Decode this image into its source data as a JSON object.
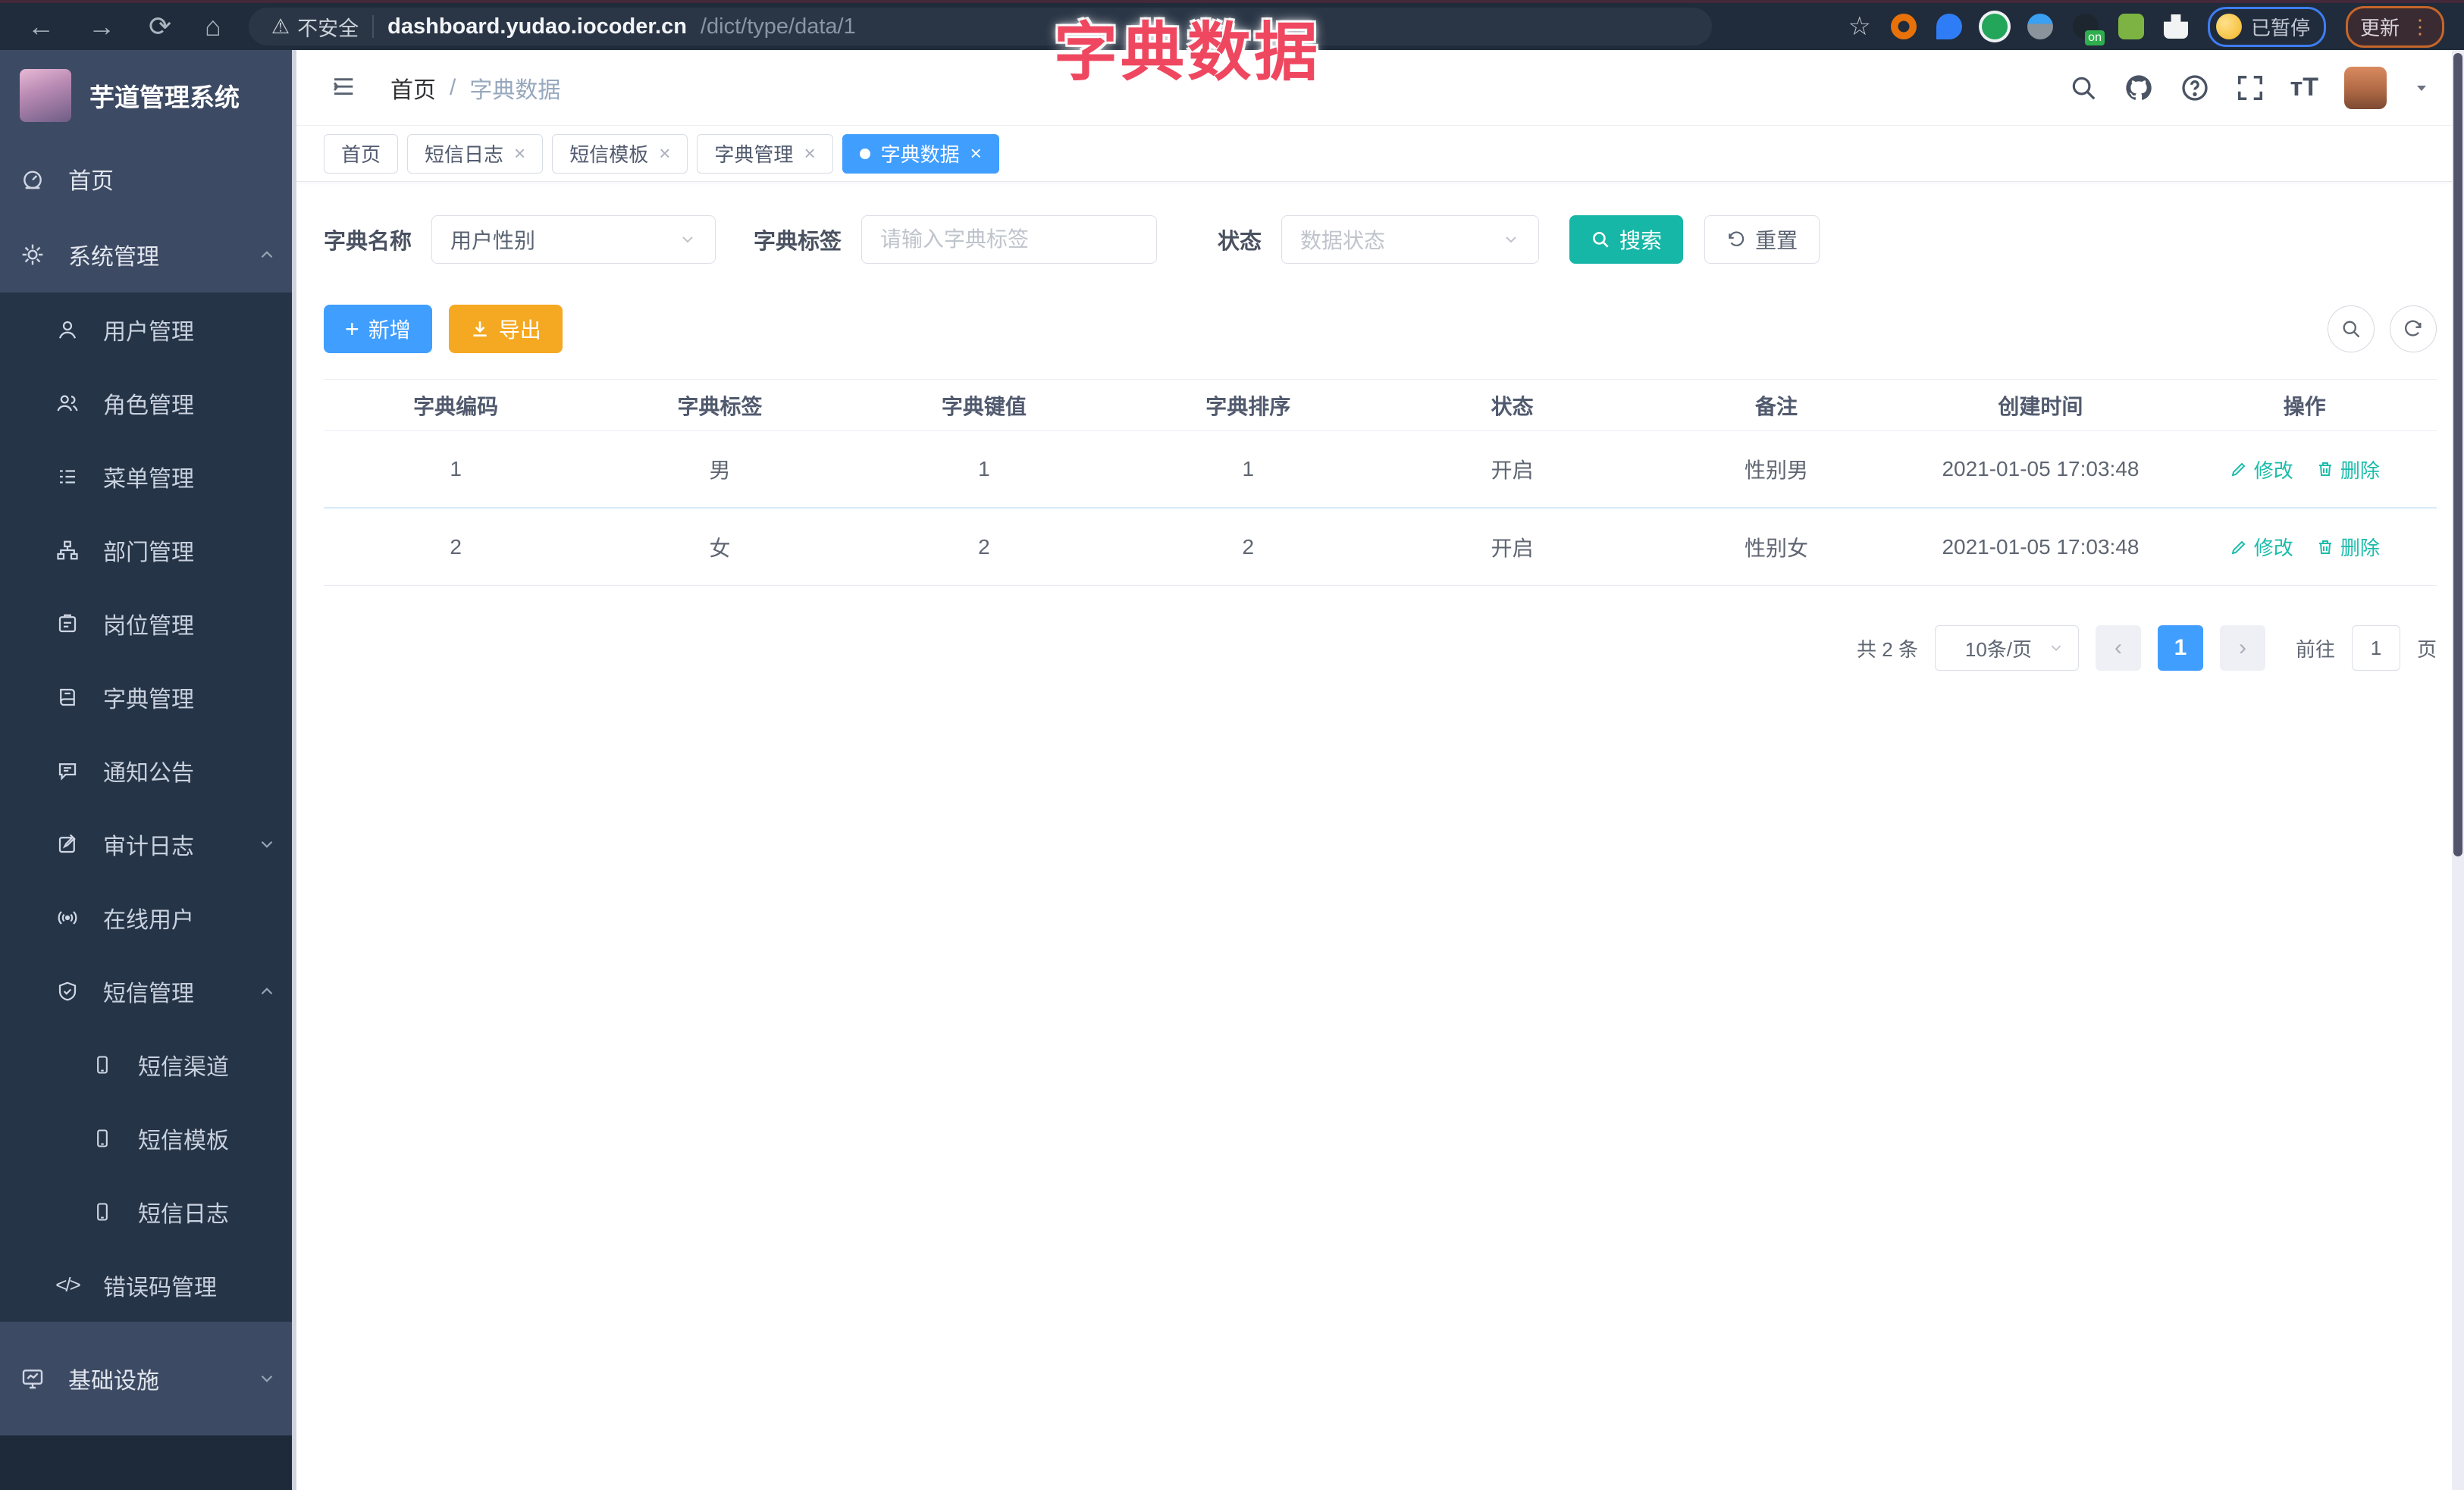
{
  "colors": {
    "primary": "#409eff",
    "teal": "#16b7a7",
    "warning_orange": "#f5a821",
    "overlay_pink": "#ef4760",
    "sidebar_dark": "#253447",
    "sidebar_light": "#3d4a63"
  },
  "browser": {
    "warning_label": "不安全",
    "url_host": "dashboard.yudao.iocoder.cn",
    "url_path": "/dict/type/data/1",
    "on_badge": "on",
    "paused_label": "已暂停",
    "update_label": "更新"
  },
  "overlay": {
    "title": "字典数据"
  },
  "sidebar": {
    "app_title": "芋道管理系统",
    "items": [
      {
        "label": "首页"
      },
      {
        "label": "系统管理"
      },
      {
        "label": "用户管理"
      },
      {
        "label": "角色管理"
      },
      {
        "label": "菜单管理"
      },
      {
        "label": "部门管理"
      },
      {
        "label": "岗位管理"
      },
      {
        "label": "字典管理"
      },
      {
        "label": "通知公告"
      },
      {
        "label": "审计日志"
      },
      {
        "label": "在线用户"
      },
      {
        "label": "短信管理"
      },
      {
        "label": "短信渠道"
      },
      {
        "label": "短信模板"
      },
      {
        "label": "短信日志"
      },
      {
        "label": "错误码管理"
      },
      {
        "label": "基础设施"
      }
    ]
  },
  "header": {
    "breadcrumb": {
      "home": "首页",
      "sep": "/",
      "current": "字典数据"
    }
  },
  "tabs": {
    "items": [
      {
        "label": "首页"
      },
      {
        "label": "短信日志"
      },
      {
        "label": "短信模板"
      },
      {
        "label": "字典管理"
      },
      {
        "label": "字典数据"
      }
    ],
    "close_glyph": "×"
  },
  "filters": {
    "dict_name_label": "字典名称",
    "dict_name_value": "用户性别",
    "dict_label_label": "字典标签",
    "dict_label_placeholder": "请输入字典标签",
    "status_label": "状态",
    "status_placeholder": "数据状态",
    "search_label": "搜索",
    "reset_label": "重置"
  },
  "toolbar": {
    "add_label": "新增",
    "export_label": "导出"
  },
  "table": {
    "headers": [
      "字典编码",
      "字典标签",
      "字典键值",
      "字典排序",
      "状态",
      "备注",
      "创建时间",
      "操作"
    ],
    "rows": [
      {
        "cells": [
          "1",
          "男",
          "1",
          "1",
          "开启",
          "性别男",
          "2021-01-05 17:03:48"
        ],
        "edit": "修改",
        "delete": "删除"
      },
      {
        "cells": [
          "2",
          "女",
          "2",
          "2",
          "开启",
          "性别女",
          "2021-01-05 17:03:48"
        ],
        "edit": "修改",
        "delete": "删除"
      }
    ]
  },
  "pagination": {
    "total": "共 2 条",
    "page_size": "10条/页",
    "page": "1",
    "goto_label": "前往",
    "goto_value": "1",
    "page_unit": "页"
  }
}
